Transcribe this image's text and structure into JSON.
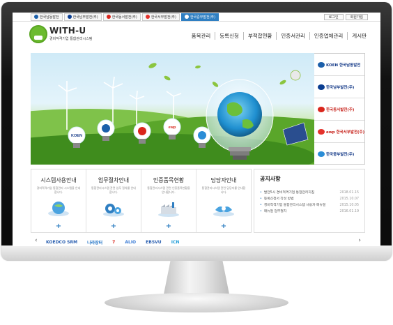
{
  "top_tabs": [
    {
      "label": "한국남동발전",
      "icon": "koen-logo-icon",
      "active": false
    },
    {
      "label": "한국남부발전(주)",
      "icon": "kospo-logo-icon",
      "active": false
    },
    {
      "label": "한국동서발전(주)",
      "icon": "ewp-logo-icon",
      "active": false
    },
    {
      "label": "한국서부발전(주)",
      "icon": "wp-logo-icon",
      "active": false
    },
    {
      "label": "한국중부발전(주)",
      "icon": "komipo-logo-icon",
      "active": true
    }
  ],
  "utility": {
    "login": "로그인",
    "join": "회원가입"
  },
  "header": {
    "title": "WITH-U",
    "subtitle": "경비적격기업 통합관리시스템"
  },
  "nav": [
    "품목관리",
    "등록신청",
    "부적합현황",
    "인증서관리",
    "인증업체관리",
    "게시판"
  ],
  "banner": {
    "bulbs": [
      {
        "label": "KOEN"
      },
      {
        "label": ""
      },
      {
        "label": ""
      },
      {
        "label": "ewp"
      },
      {
        "label": ""
      }
    ]
  },
  "side_companies": [
    {
      "label": "KOEN 한국남동발전",
      "cls": "c1",
      "icon": "koen-logo-icon"
    },
    {
      "label": "한국남부발전(주)",
      "cls": "c2",
      "icon": "kospo-logo-icon"
    },
    {
      "label": "한국동서발전(주)",
      "cls": "c3",
      "icon": "ewp-logo-icon"
    },
    {
      "label": "ewp 한국서부발전(주)",
      "cls": "c4",
      "icon": "wp-logo-icon"
    },
    {
      "label": "한국중부발전(주)",
      "cls": "c5",
      "icon": "komipo-logo-icon"
    }
  ],
  "services": [
    {
      "title": "시스템사용안내",
      "desc": "경비적격기업 통합관리 시스템을 안내합니다."
    },
    {
      "title": "업무절차안내",
      "desc": "통합관리시스템 관련 업무 절차를 안내합니다."
    },
    {
      "title": "인증품목현황",
      "desc": "통합관리시스템 관련 인증품목현황을 안내합니다."
    },
    {
      "title": "담당자안내",
      "desc": "통합관리시스템 관련 담당자를 안내합니다."
    }
  ],
  "notice": {
    "title": "공지사항",
    "items": [
      {
        "text": "발전5사 경비적격기업 통합관리지침",
        "date": "2018.01.15"
      },
      {
        "text": "등록신청서 작성 방법",
        "date": "2015.10.07"
      },
      {
        "text": "경비적격기업 통합관리시스템 사용자 매뉴얼",
        "date": "2015.10.05"
      },
      {
        "text": "매뉴얼 업무절차",
        "date": "2016.01.19"
      }
    ]
  },
  "partners": [
    {
      "label": "KOEDCO SRM",
      "color": "#2a5fb0"
    },
    {
      "label": "나라장터",
      "color": "#1a6fc4"
    },
    {
      "label": "7",
      "color": "#d9261c"
    },
    {
      "label": "ALIO",
      "color": "#3a7bd5"
    },
    {
      "label": "EBSVU",
      "color": "#2a5fb0"
    },
    {
      "label": "ICN",
      "color": "#1e9bd7"
    }
  ],
  "colors": {
    "accent": "#2f7fc2",
    "logo_green": "#6cbb2f",
    "partner_arrows": "#777777"
  }
}
